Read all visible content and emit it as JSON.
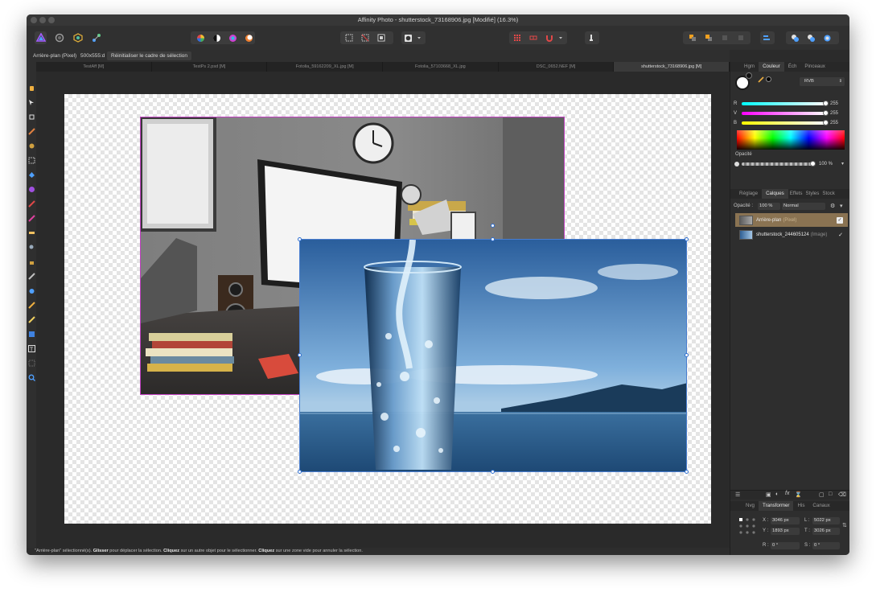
{
  "app": {
    "title": "Affinity Photo - shutterstock_73168906.jpg [Modifié] (16.3%)"
  },
  "context_bar": {
    "layer_label": "Arrière-plan (Pixel)",
    "size_label": "500x555:d",
    "reset_button": "Réinitialiser le cadre de sélection"
  },
  "doc_tabs": [
    "TestAff [M]",
    "TestPs 2.psd [M]",
    "Fotolia_59162209_XL.jpg [M]",
    "Fotolia_57103668_XL.jpg",
    "DSC_0652.NEF [M]",
    "shutterstock_73168906.jpg [M]"
  ],
  "status": {
    "p1": "\"Arrière-plan\" sélectionné(s).",
    "b1": "Glisser",
    "p2": "pour déplacer la sélection.",
    "b2": "Cliquez",
    "p3": "sur un autre objet pour le sélectionner.",
    "b3": "Cliquez",
    "p4": "sur une zone vide pour annuler la sélection."
  },
  "color_panel": {
    "tabs": [
      "Hgm",
      "Couleur",
      "Éch",
      "Pinceaux"
    ],
    "active_tab": "Couleur",
    "mode": "RVB",
    "channels": [
      {
        "label": "R",
        "value": "255",
        "fraction": 1.0
      },
      {
        "label": "V",
        "value": "255",
        "fraction": 1.0
      },
      {
        "label": "B",
        "value": "255",
        "fraction": 1.0
      }
    ],
    "opacity_label": "Opacité",
    "opacity_value": "100 %",
    "opacity_fraction": 1.0
  },
  "layers_panel": {
    "tabs": [
      "Réglage",
      "Calques",
      "Effets",
      "Styles",
      "Stock"
    ],
    "active_tab": "Calques",
    "opacity_label": "Opacité :",
    "opacity_value": "100 %",
    "blend_mode": "Normal",
    "layers": [
      {
        "name": "Arrière-plan",
        "type": "(Pixel)",
        "selected": true
      },
      {
        "name": "shutterstock_244605124",
        "type": "(Image)",
        "selected": false
      }
    ]
  },
  "transform_panel": {
    "tabs": [
      "Nvg",
      "Transformer",
      "His",
      "Canaux"
    ],
    "active_tab": "Transformer",
    "x_label": "X :",
    "x_value": "3046 px",
    "y_label": "Y :",
    "y_value": "1893 px",
    "l_label": "L :",
    "l_value": "5022 px",
    "t_label": "T :",
    "t_value": "3026 px",
    "r_label": "R :",
    "r_value": "0 °",
    "s_label": "S :",
    "s_value": "0 °"
  },
  "colors": {
    "selection_pink": "#c040c0",
    "selection_blue": "#2f6fd0",
    "layer_selected_bg": "#8a7352",
    "accent_purple": "#8b3fd9"
  }
}
